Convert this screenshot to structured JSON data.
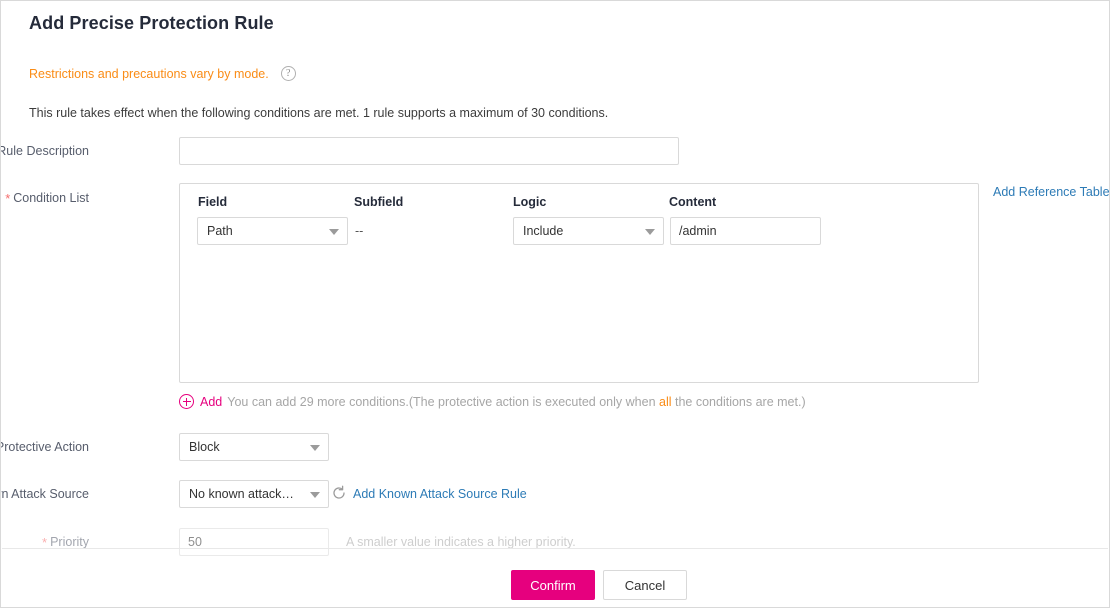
{
  "dialog": {
    "title": "Add Precise Protection Rule",
    "notice": "Restrictions and precautions vary by mode.",
    "help_icon": "question-circle-icon",
    "subnote": "This rule takes effect when the following conditions are met. 1 rule supports a maximum of 30 conditions."
  },
  "form": {
    "rule_description": {
      "label": "Rule Description",
      "value": "",
      "placeholder": ""
    },
    "condition_list": {
      "label": "Condition List",
      "required_marker": "*",
      "columns": [
        "Field",
        "Subfield",
        "Logic",
        "Content"
      ],
      "rows": [
        {
          "field": "Path",
          "subfield": "--",
          "logic": "Include",
          "content": "/admin"
        }
      ],
      "reference_table_link": "Add Reference Table",
      "add_link": "Add",
      "add_icon": "plus-circle-icon",
      "add_description_before": "You can add 29 more conditions.(The protective action is executed only when ",
      "add_description_highlight": "all",
      "add_description_after": " the conditions are met.)"
    },
    "protective_action": {
      "label": "Protective Action",
      "required_marker": "*",
      "value": "Block"
    },
    "known_attack_source": {
      "label": "Known Attack Source",
      "required_marker": "*",
      "value": "No known attack…",
      "refresh_icon": "refresh-icon",
      "link": "Add Known Attack Source Rule"
    },
    "priority": {
      "label": "Priority",
      "required_marker": "*",
      "value": "50",
      "hint": "A smaller value indicates a higher priority."
    }
  },
  "footer": {
    "confirm_label": "Confirm",
    "cancel_label": "Cancel"
  },
  "colors": {
    "accent_pink": "#e6007e",
    "warning_orange": "#fa8c16",
    "link_blue": "#2d7bb6",
    "required_red": "#f56c6c"
  }
}
